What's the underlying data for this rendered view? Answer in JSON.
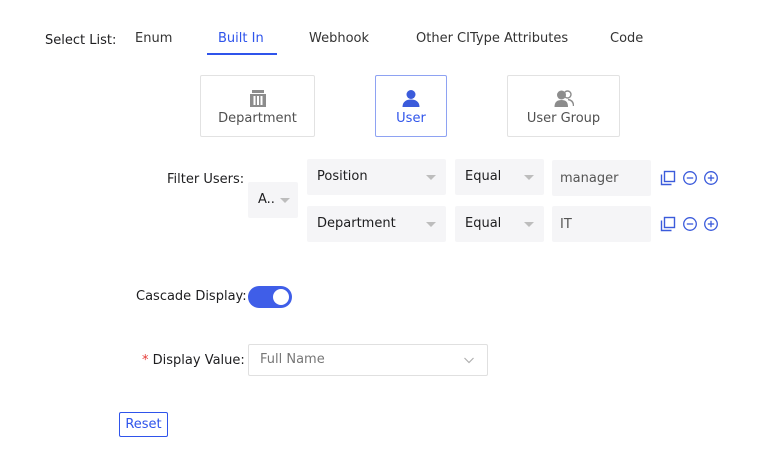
{
  "select_list": {
    "label": "Select List:",
    "tabs": [
      {
        "label": "Enum",
        "active": false
      },
      {
        "label": "Built In",
        "active": true
      },
      {
        "label": "Webhook",
        "active": false
      },
      {
        "label": "Other CIType Attributes",
        "active": false
      },
      {
        "label": "Code",
        "active": false
      }
    ]
  },
  "built_in": {
    "options": [
      {
        "label": "Department",
        "icon": "building-icon",
        "active": false
      },
      {
        "label": "User",
        "icon": "user-icon",
        "active": true
      },
      {
        "label": "User Group",
        "icon": "user-group-icon",
        "active": false
      }
    ]
  },
  "filter": {
    "label": "Filter Users:",
    "logic": "A..",
    "rows": [
      {
        "field": "Position",
        "operator": "Equal",
        "value": "manager"
      },
      {
        "field": "Department",
        "operator": "Equal",
        "value": "IT"
      }
    ]
  },
  "cascade": {
    "label": "Cascade Display:",
    "enabled": true
  },
  "display_value": {
    "required_mark": "*",
    "label": "Display Value:",
    "value": "Full Name"
  },
  "reset_label": "Reset",
  "colors": {
    "accent": "#2f54eb",
    "toggle_on": "#3f5ee8",
    "field_bg": "#f5f5f7"
  }
}
